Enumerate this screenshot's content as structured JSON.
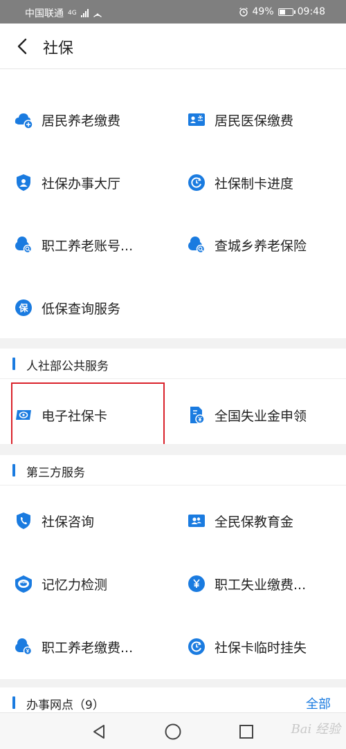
{
  "status_bar": {
    "carrier": "中国联通",
    "network": "4G",
    "battery": "49%",
    "battery_level": 0.49,
    "time": "09:48"
  },
  "header": {
    "title": "社保"
  },
  "top_grid": [
    {
      "label": "居民养老缴费",
      "icon": "pension-cloud-plus-icon"
    },
    {
      "label": "居民医保缴费",
      "icon": "medical-card-icon"
    },
    {
      "label": "社保办事大厅",
      "icon": "shield-person-icon"
    },
    {
      "label": "社保制卡进度",
      "icon": "progress-clock-icon"
    },
    {
      "label": "职工养老账号...",
      "icon": "pension-search-icon"
    },
    {
      "label": "查城乡养老保险",
      "icon": "pension-search-icon"
    },
    {
      "label": "低保查询服务",
      "icon": "bao-badge-icon"
    }
  ],
  "section_mohrss": {
    "title": "人社部公共服务"
  },
  "mohrss_grid": [
    {
      "label": "电子社保卡",
      "icon": "e-card-icon"
    },
    {
      "label": "全国失业金申领",
      "icon": "document-yuan-icon"
    }
  ],
  "section_third": {
    "title": "第三方服务"
  },
  "third_grid": [
    {
      "label": "社保咨询",
      "icon": "shield-phone-icon"
    },
    {
      "label": "全民保教育金",
      "icon": "card-people-icon"
    },
    {
      "label": "记忆力检测",
      "icon": "brain-shield-icon"
    },
    {
      "label": "职工失业缴费...",
      "icon": "yuan-circle-icon"
    },
    {
      "label": "职工养老缴费...",
      "icon": "pension-yuan-icon"
    },
    {
      "label": "社保卡临时挂失",
      "icon": "progress-clock-icon"
    }
  ],
  "section_outlets": {
    "title": "办事网点（9）",
    "more": "全部"
  },
  "watermark": "Bai 经验",
  "colors": {
    "accent": "#1a7be0",
    "highlight": "#d9212a"
  }
}
